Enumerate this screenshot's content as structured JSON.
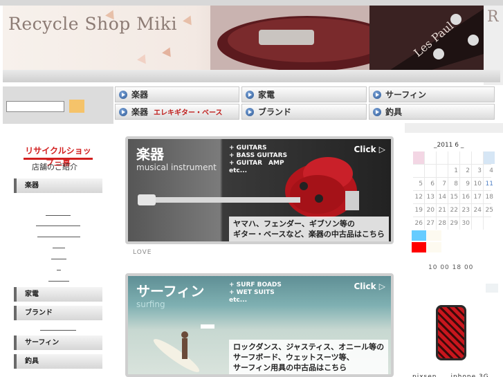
{
  "header": {
    "site_title": "Recycle Shop Miki",
    "right_letter": "R"
  },
  "search": {
    "value": "",
    "placeholder": ""
  },
  "nav": {
    "items": [
      {
        "label": "楽器"
      },
      {
        "label": "家電"
      },
      {
        "label": "サーフィン"
      },
      {
        "label": "楽器",
        "sub": "エレキギター・ベース"
      },
      {
        "label": "ブランド"
      },
      {
        "label": "釣具"
      }
    ]
  },
  "sidebar": {
    "logo_text": "リサイクルショップ三喜",
    "logo_sub": "店舗のご紹介",
    "items": [
      {
        "label": "楽器"
      },
      {
        "label": "家電"
      },
      {
        "label": "ブランド"
      },
      {
        "label": "サーフィン"
      },
      {
        "label": "釣具"
      }
    ]
  },
  "banners": [
    {
      "title": "楽器",
      "subtitle": "musical instrument",
      "bullets": [
        "+ GUITARS",
        "+ BASS GUITARS",
        "+ GUITAR　AMP",
        "etc..."
      ],
      "click": "Click",
      "desc": [
        "ヤマハ、フェンダー、ギブソン等の",
        "ギター・ベースなど、楽器の中古品はこちら"
      ]
    },
    {
      "title": "サーフィン",
      "subtitle": "surfing",
      "bullets": [
        "+ SURF BOADS",
        "+ WET SUITS",
        "etc..."
      ],
      "click": "Click",
      "desc": [
        "ロックダンス、ジャスティス、オニール等の",
        "サーフボード、ウェットスーツ等、",
        "サーフィン用具の中古品はこちら"
      ]
    }
  ],
  "love_text": "LOVE",
  "calendar": {
    "title": "_2011 6 _",
    "rows": [
      [
        "",
        "",
        "",
        "1",
        "2",
        "3",
        "4"
      ],
      [
        "5",
        "6",
        "7",
        "8",
        "9",
        "10",
        "11"
      ],
      [
        "12",
        "13",
        "14",
        "15",
        "16",
        "17",
        "18"
      ],
      [
        "19",
        "20",
        "21",
        "22",
        "23",
        "24",
        "25"
      ],
      [
        "26",
        "27",
        "28",
        "29",
        "30",
        "",
        ""
      ]
    ],
    "hours": "10 00 18 00",
    "legend_colors": [
      "#66ccff",
      "#ff0000"
    ]
  },
  "product": {
    "caption": "pixsen　　iphone 3G"
  },
  "colors": {
    "accent_red": "#d21f1f",
    "search_button": "#f5c36a",
    "nav_icon": "#2f5a96"
  }
}
